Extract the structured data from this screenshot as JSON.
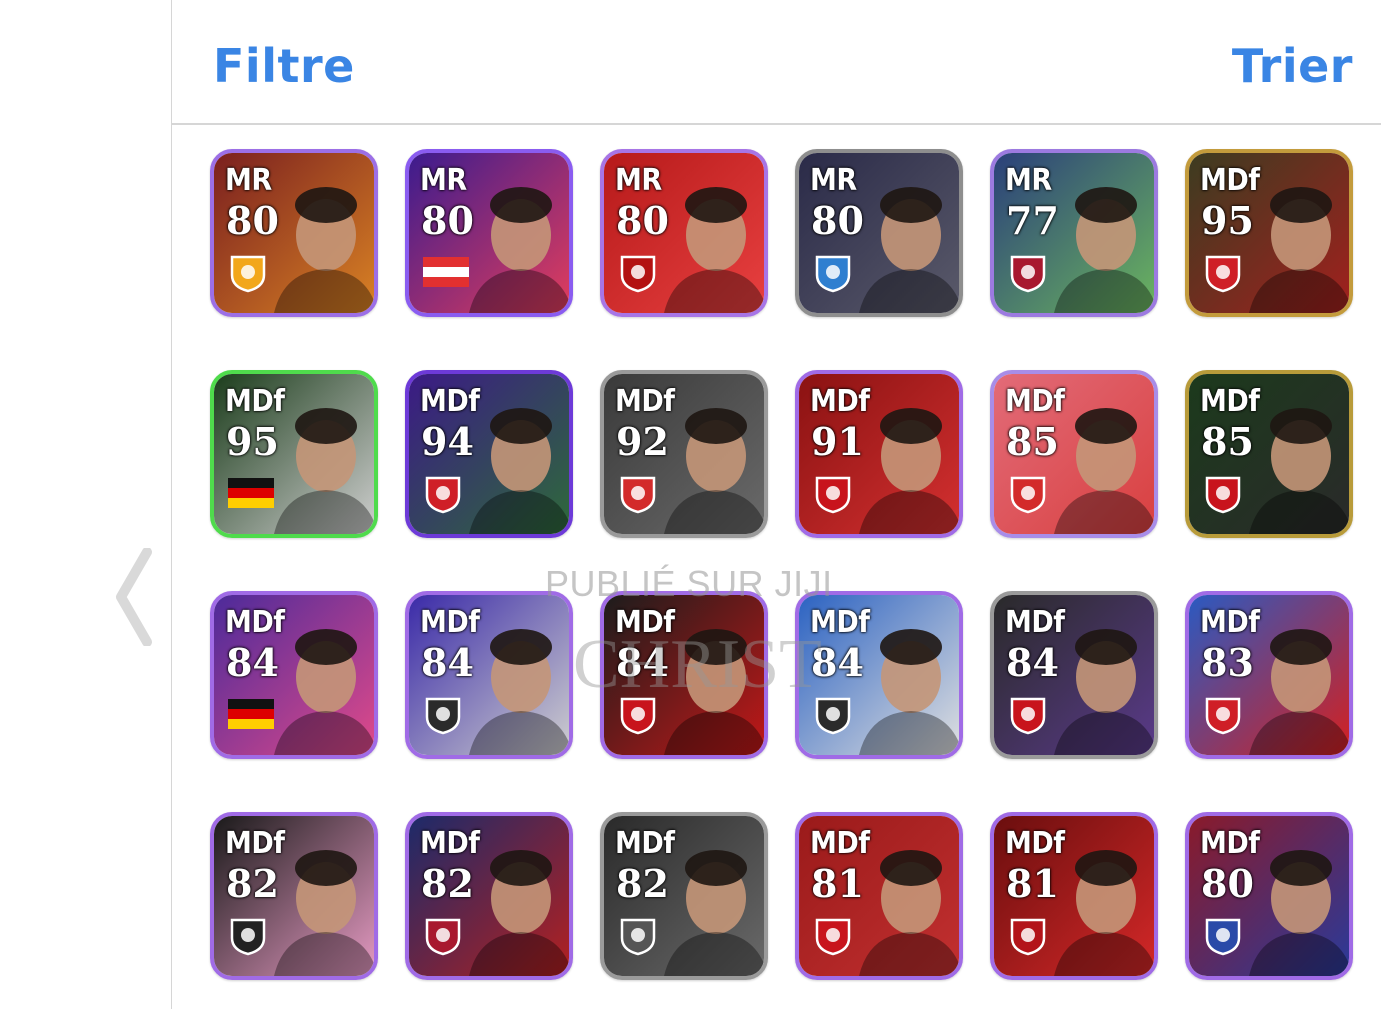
{
  "header": {
    "filter_label": "Filtre",
    "sort_label": "Trier"
  },
  "watermark": {
    "line1": "PUBLIÉ SUR JIJI",
    "line2": "CHRIST"
  },
  "cards": [
    {
      "pos": "MR",
      "ovr": "80",
      "border": "#9c6fe6",
      "bg": [
        "#7a1f1f",
        "#d98224"
      ],
      "badge": "crest",
      "badge_color": "#f2a71b"
    },
    {
      "pos": "MR",
      "ovr": "80",
      "border": "#8a5cf0",
      "bg": [
        "#3b1b8e",
        "#e23d5d"
      ],
      "badge": "flag-austria",
      "badge_color": "#e23030"
    },
    {
      "pos": "MR",
      "ovr": "80",
      "border": "#a775e6",
      "bg": [
        "#b61a1a",
        "#e84040"
      ],
      "badge": "crest",
      "badge_color": "#b31111"
    },
    {
      "pos": "MR",
      "ovr": "80",
      "border": "#8e8e8e",
      "bg": [
        "#2a2a48",
        "#5a5a6a"
      ],
      "badge": "crest",
      "badge_color": "#2f7fd0"
    },
    {
      "pos": "MR",
      "ovr": "77",
      "border": "#9c7ae0",
      "bg": [
        "#2a3f7a",
        "#6bb55f"
      ],
      "badge": "crest",
      "badge_color": "#a8192f"
    },
    {
      "pos": "MDf",
      "ovr": "95",
      "border": "#c39b3c",
      "bg": [
        "#3c3c20",
        "#a2201e"
      ],
      "badge": "crest",
      "badge_color": "#cf1f27"
    },
    {
      "pos": "MDf",
      "ovr": "95",
      "border": "#4fdb4c",
      "bg": [
        "#1c3d1c",
        "#cfcfcf"
      ],
      "badge": "flag-germany",
      "badge_color": "#111111"
    },
    {
      "pos": "MDf",
      "ovr": "94",
      "border": "#6d3ad8",
      "bg": [
        "#3b1a86",
        "#2e6a3a"
      ],
      "badge": "crest",
      "badge_color": "#cf1f27"
    },
    {
      "pos": "MDf",
      "ovr": "92",
      "border": "#9a9a9a",
      "bg": [
        "#3a3a3a",
        "#6a6a6a"
      ],
      "badge": "crest",
      "badge_color": "#d32b2b"
    },
    {
      "pos": "MDf",
      "ovr": "91",
      "border": "#a06be6",
      "bg": [
        "#8a1212",
        "#d43030"
      ],
      "badge": "crest",
      "badge_color": "#c8141c"
    },
    {
      "pos": "MDf",
      "ovr": "85",
      "border": "#a88de8",
      "bg": [
        "#e26b78",
        "#d94040"
      ],
      "badge": "crest",
      "badge_color": "#d32b2b"
    },
    {
      "pos": "MDf",
      "ovr": "85",
      "border": "#b89b3a",
      "bg": [
        "#1c3a1c",
        "#2a2a2a"
      ],
      "badge": "crest",
      "badge_color": "#c8141c"
    },
    {
      "pos": "MDf",
      "ovr": "84",
      "border": "#a06be6",
      "bg": [
        "#4c2a9a",
        "#e04a8a"
      ],
      "badge": "flag-germany",
      "badge_color": "#111111"
    },
    {
      "pos": "MDf",
      "ovr": "84",
      "border": "#a06be6",
      "bg": [
        "#3a2aa8",
        "#cfcfcf"
      ],
      "badge": "crest",
      "badge_color": "#2b2b2b"
    },
    {
      "pos": "MDf",
      "ovr": "84",
      "border": "#a06be6",
      "bg": [
        "#1c1c1c",
        "#c21818"
      ],
      "badge": "crest",
      "badge_color": "#c8141c"
    },
    {
      "pos": "MDf",
      "ovr": "84",
      "border": "#a06be6",
      "bg": [
        "#2b62c2",
        "#e0e0e0"
      ],
      "badge": "crest",
      "badge_color": "#2b2b2b"
    },
    {
      "pos": "MDf",
      "ovr": "84",
      "border": "#9a9a9a",
      "bg": [
        "#2a2a2a",
        "#5a3a8a"
      ],
      "badge": "crest",
      "badge_color": "#c8141c"
    },
    {
      "pos": "MDf",
      "ovr": "83",
      "border": "#a06be6",
      "bg": [
        "#2a5ac2",
        "#d42020"
      ],
      "badge": "crest",
      "badge_color": "#cf1f27"
    },
    {
      "pos": "MDf",
      "ovr": "82",
      "border": "#a06be6",
      "bg": [
        "#1a1a1a",
        "#e59ac2"
      ],
      "badge": "crest",
      "badge_color": "#222222"
    },
    {
      "pos": "MDf",
      "ovr": "82",
      "border": "#a06be6",
      "bg": [
        "#1c2a6a",
        "#b32020"
      ],
      "badge": "crest",
      "badge_color": "#a8192f"
    },
    {
      "pos": "MDf",
      "ovr": "82",
      "border": "#9a9a9a",
      "bg": [
        "#2a2a2a",
        "#6a6a6a"
      ],
      "badge": "crest",
      "badge_color": "#555555"
    },
    {
      "pos": "MDf",
      "ovr": "81",
      "border": "#a06be6",
      "bg": [
        "#9a1a1a",
        "#c23030"
      ],
      "badge": "crest",
      "badge_color": "#c8141c"
    },
    {
      "pos": "MDf",
      "ovr": "81",
      "border": "#a06be6",
      "bg": [
        "#6a0e0e",
        "#d42828"
      ],
      "badge": "crest",
      "badge_color": "#b3141a"
    },
    {
      "pos": "MDf",
      "ovr": "80",
      "border": "#a06be6",
      "bg": [
        "#8a1a2a",
        "#2a3a9a"
      ],
      "badge": "crest",
      "badge_color": "#2a4aa8"
    }
  ]
}
